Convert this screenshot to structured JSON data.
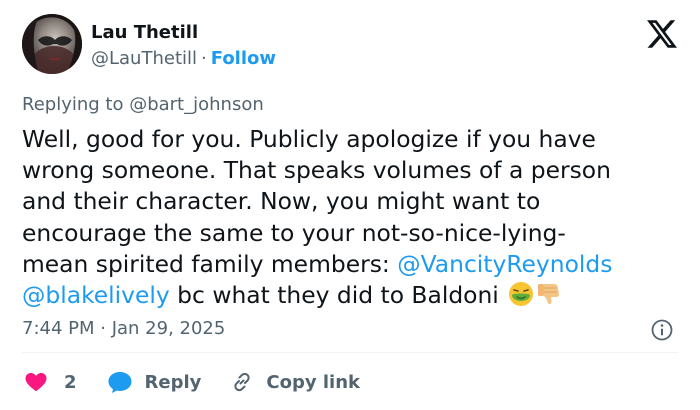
{
  "author": {
    "name": "Lau Thetill",
    "handle": "@LauThetill",
    "separator": "·",
    "follow_label": "Follow"
  },
  "platform_icon": "x-logo-icon",
  "replying": {
    "prefix": "Replying to ",
    "handle": "@bart_johnson"
  },
  "tweet": {
    "line1": "Well, good for you. Publicly apologize if you have",
    "line2": "wrong someone. That speaks volumes of a person",
    "line3": "and their character. Now, you might want to",
    "line4": "encourage the same to your not-so-nice-lying-",
    "line5_text": "mean spirited family members: ",
    "mention1": "@VancityReynolds",
    "mention2": "@blakelively",
    "line6_text": " bc what they did to Baldoni ",
    "emojis": [
      "nauseated-face-icon",
      "thumbs-down-icon"
    ]
  },
  "timestamp": "7:44 PM · Jan 29, 2025",
  "actions": {
    "like_count": "2",
    "reply_label": "Reply",
    "copy_link_label": "Copy link"
  },
  "colors": {
    "accent": "#1d9bf0",
    "like": "#f91880",
    "text": "#0f1419",
    "muted": "#536471"
  }
}
